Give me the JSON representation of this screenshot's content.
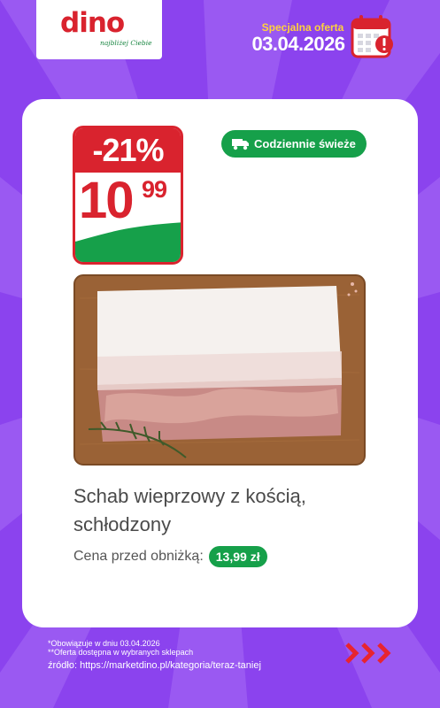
{
  "header": {
    "logo_text": "dino",
    "logo_tagline": "najbliżej Ciebie",
    "offer_label": "Specjalna oferta",
    "offer_date": "03.04.2026",
    "calendar_icon": "calendar-alert-icon"
  },
  "product": {
    "discount": "-21%",
    "price_main": "10",
    "price_cents": "99",
    "fresh_badge": "Codziennie świeże",
    "fresh_icon": "delivery-truck-icon",
    "name": "Schab wieprzowy z kością, schłodzony",
    "prev_price_label": "Cena przed obniżką:",
    "prev_price": "13,99 zł"
  },
  "footer": {
    "note1": "*Obowiązuje w dniu 03.04.2026",
    "note2": "**Oferta dostępna w wybranych sklepach",
    "source": "źródło: https://marketdino.pl/kategoria/teraz-taniej",
    "arrows_icon": "triple-chevron-right-icon"
  },
  "colors": {
    "background": "#8b43ee",
    "brand_red": "#d9232e",
    "brand_green": "#16a04a",
    "offer_yellow": "#ffd23c"
  }
}
